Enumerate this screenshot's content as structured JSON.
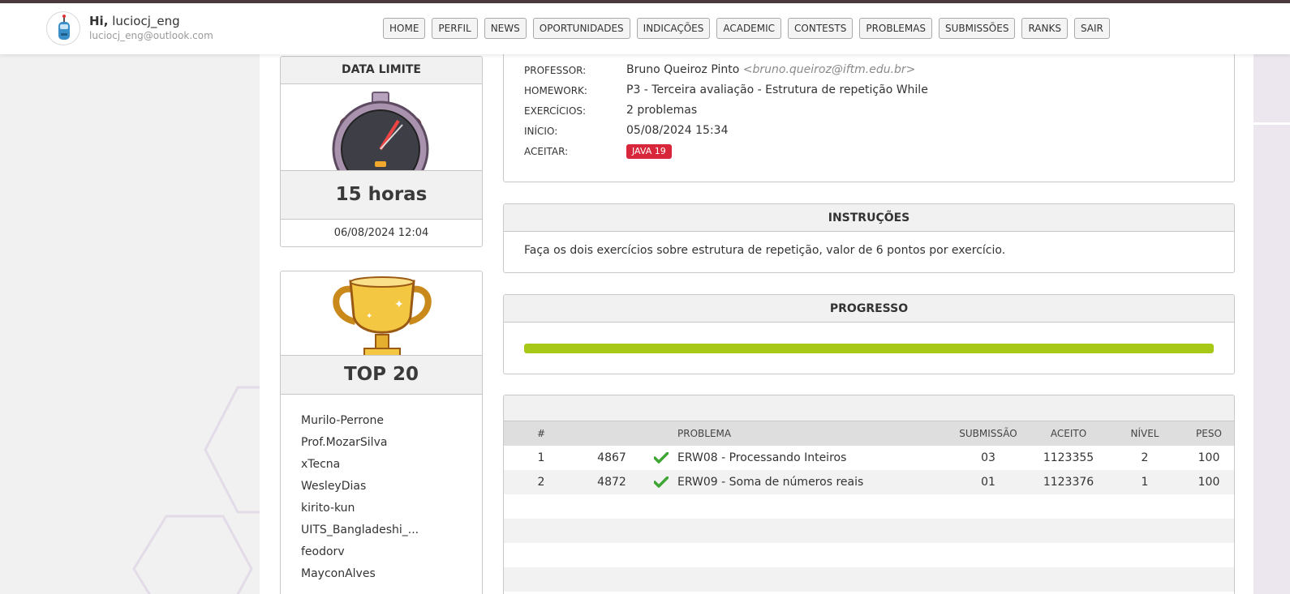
{
  "header": {
    "greeting": "Hi,",
    "username": "luciocj_eng",
    "email": "luciocj_eng@outlook.com",
    "nav": [
      "HOME",
      "PERFIL",
      "NEWS",
      "OPORTUNIDADES",
      "INDICAÇÕES",
      "ACADEMIC",
      "CONTESTS",
      "PROBLEMAS",
      "SUBMISSÕES",
      "RANKS",
      "SAIR"
    ]
  },
  "deadline": {
    "title": "DATA LIMITE",
    "remaining": "15 horas",
    "date": "06/08/2024 12:04"
  },
  "top20": {
    "title": "TOP 20",
    "names": [
      "Murilo-Perrone",
      "Prof.MozarSilva",
      "xTecna",
      "WesleyDias",
      "kirito-kun",
      "UITS_Bangladeshi_...",
      "feodorv",
      "MayconAlves"
    ]
  },
  "info": {
    "rows": [
      {
        "label": "PROFESSOR:",
        "value": "Bruno Queiroz Pinto",
        "email": "<bruno.queiroz@iftm.edu.br>"
      },
      {
        "label": "HOMEWORK:",
        "value": "P3 - Terceira avaliação - Estrutura de repetição While"
      },
      {
        "label": "EXERCÍCIOS:",
        "value": "2 problemas"
      },
      {
        "label": "INÍCIO:",
        "value": "05/08/2024 15:34"
      },
      {
        "label": "ACEITAR:",
        "badge": "JAVA 19"
      }
    ]
  },
  "instructions": {
    "title": "INSTRUÇÕES",
    "text": "Faça os dois exercícios sobre estrutura de repetição, valor de 6 pontos por exercício."
  },
  "progress": {
    "title": "PROGRESSO",
    "fraction": 1.0
  },
  "problems": {
    "columns": [
      "#",
      "",
      "",
      "PROBLEMA",
      "SUBMISSÃO",
      "ACEITO",
      "NÍVEL",
      "PESO"
    ],
    "rows": [
      {
        "n": "1",
        "id": "4867",
        "name": "ERW08 - Processando Inteiros",
        "submission": "03",
        "accepted": "1123355",
        "level": "2",
        "weight": "100"
      },
      {
        "n": "2",
        "id": "4872",
        "name": "ERW09 - Soma de números reais",
        "submission": "01",
        "accepted": "1123376",
        "level": "1",
        "weight": "100"
      }
    ]
  },
  "colors": {
    "accent_green": "#a8c818",
    "badge_red": "#d8263a",
    "check_green": "#3fa535"
  }
}
